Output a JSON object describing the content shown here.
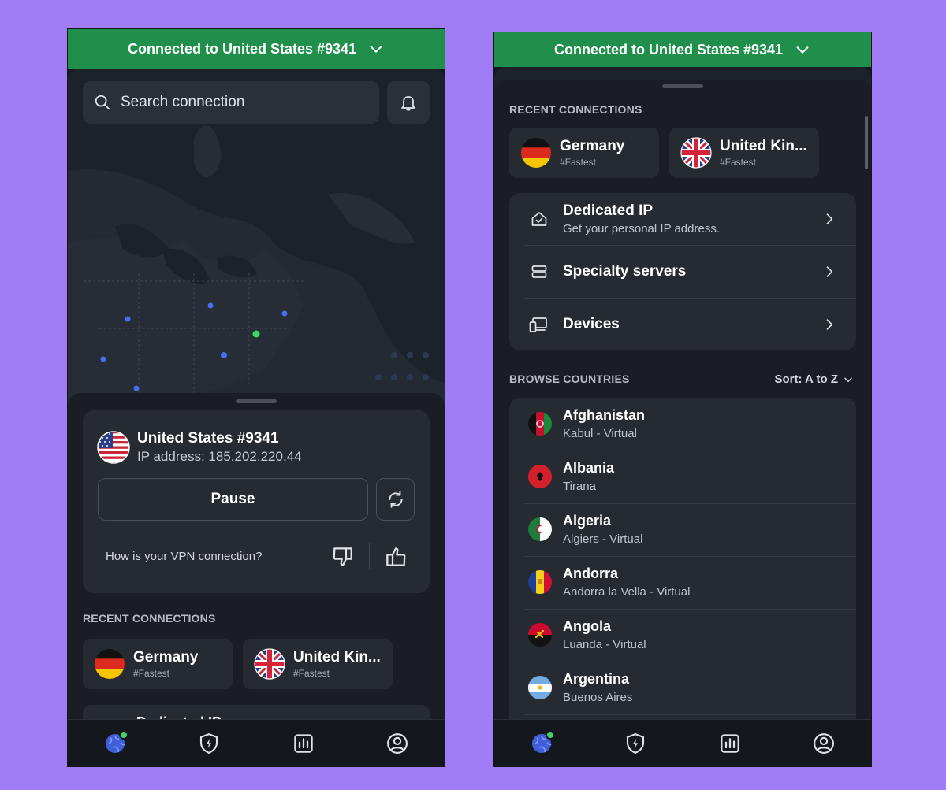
{
  "connection_bar": {
    "text": "Connected to United States #9341"
  },
  "search": {
    "placeholder": "Search connection"
  },
  "status": {
    "server": "United States #9341",
    "ip": "IP address: 185.202.220.44",
    "pause_label": "Pause",
    "feedback_question": "How is your VPN connection?"
  },
  "recent": {
    "label": "RECENT CONNECTIONS",
    "items": [
      {
        "name": "Germany",
        "tag": "#Fastest"
      },
      {
        "name": "United Kin...",
        "tag": "#Fastest"
      }
    ]
  },
  "menu": {
    "items": [
      {
        "title": "Dedicated IP",
        "subtitle": "Get your personal IP address."
      },
      {
        "title": "Specialty servers",
        "subtitle": ""
      },
      {
        "title": "Devices",
        "subtitle": ""
      }
    ]
  },
  "browse": {
    "label": "BROWSE COUNTRIES",
    "sort_label": "Sort: A to Z",
    "countries": [
      {
        "name": "Afghanistan",
        "city": "Kabul - Virtual"
      },
      {
        "name": "Albania",
        "city": "Tirana"
      },
      {
        "name": "Algeria",
        "city": "Algiers - Virtual"
      },
      {
        "name": "Andorra",
        "city": "Andorra la Vella - Virtual"
      },
      {
        "name": "Angola",
        "city": "Luanda - Virtual"
      },
      {
        "name": "Argentina",
        "city": "Buenos Aires"
      }
    ]
  },
  "tabs": [
    {
      "icon": "globe-icon",
      "active": true
    },
    {
      "icon": "shield-bolt-icon"
    },
    {
      "icon": "stats-icon"
    },
    {
      "icon": "profile-icon"
    }
  ],
  "colors": {
    "background": "#a07cf5",
    "connected_green": "#1f8f4b",
    "surface": "#262a31",
    "status_dot": "#3ed36b"
  }
}
